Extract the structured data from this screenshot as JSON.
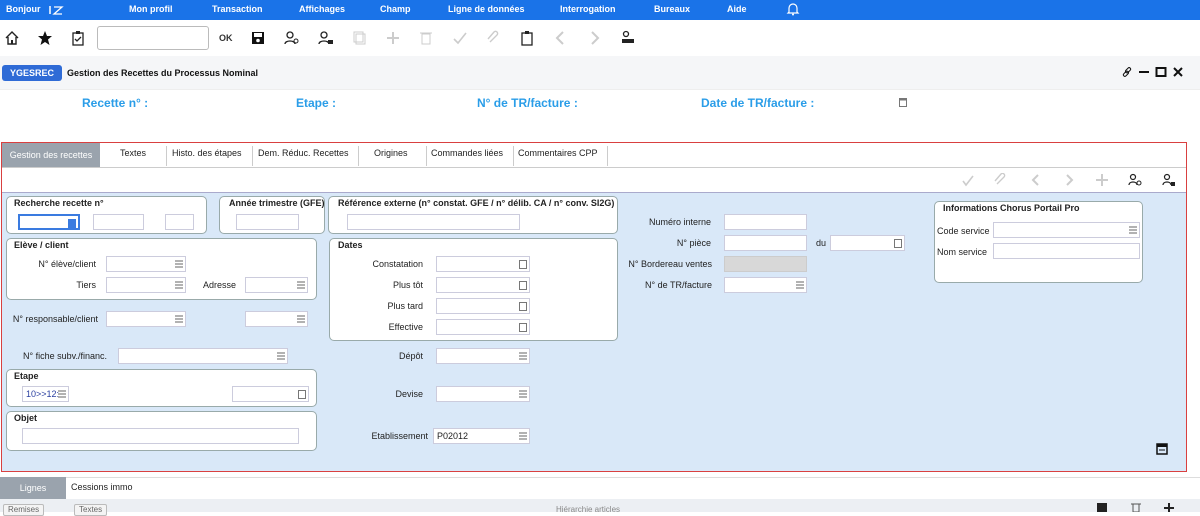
{
  "menu": {
    "greeting": "Bonjour",
    "items": [
      "Mon profil",
      "Transaction",
      "Affichages",
      "Champ",
      "Ligne de données",
      "Interrogation",
      "Bureaux",
      "Aide"
    ]
  },
  "toolbar": {
    "ok_label": "OK",
    "quick_value": ""
  },
  "window": {
    "code": "YGESREC",
    "title": "Gestion des Recettes du Processus Nominal"
  },
  "header": {
    "recette": "Recette n° :",
    "etape": "Etape :",
    "tr_facture": "N° de TR/facture :",
    "date_tr": "Date de TR/facture :"
  },
  "tabs": [
    "Gestion des recettes",
    "Textes",
    "Histo. des étapes",
    "Dem. Réduc. Recettes",
    "Origines",
    "Commandes liées",
    "Commentaires CPP"
  ],
  "form": {
    "recherche_title": "Recherche recette n°",
    "annee_title": "Année trimestre (GFE)",
    "ref_title": "Référence externe (n° constat. GFE / n° délib. CA / n° conv. SI2G)",
    "eleve_title": "Elève / client",
    "eleve_no": "N° élève/client",
    "tiers": "Tiers",
    "adresse": "Adresse",
    "responsable": "N° responsable/client",
    "fiche": "N° fiche subv./financ.",
    "etape_title": "Etape",
    "etape_value": "10>>12:",
    "objet_title": "Objet",
    "dates_title": "Dates",
    "constatation": "Constatation",
    "plus_tot": "Plus tôt",
    "plus_tard": "Plus tard",
    "effective": "Effective",
    "depot": "Dépôt",
    "devise": "Devise",
    "etablissement": "Etablissement",
    "etablissement_value": "P02012",
    "numero_interne": "Numéro interne",
    "piece": "N° pièce",
    "du": "du",
    "bordereau": "N° Bordereau ventes",
    "tr_facture": "N° de TR/facture",
    "chorus_title": "Informations Chorus Portail Pro",
    "code_service": "Code service",
    "nom_service": "Nom service"
  },
  "bottom": {
    "tab_lignes": "Lignes",
    "tab_cessions": "Cessions immo",
    "btn_remises": "Remises",
    "btn_textes": "Textes",
    "hierarchy": "Hiérarchie articles"
  },
  "colors": {
    "menubar": "#1a73e8",
    "accent": "#2a9de8",
    "badge": "#2f6bd6",
    "form_bg": "#d9e8f8",
    "frame": "#d94040"
  }
}
